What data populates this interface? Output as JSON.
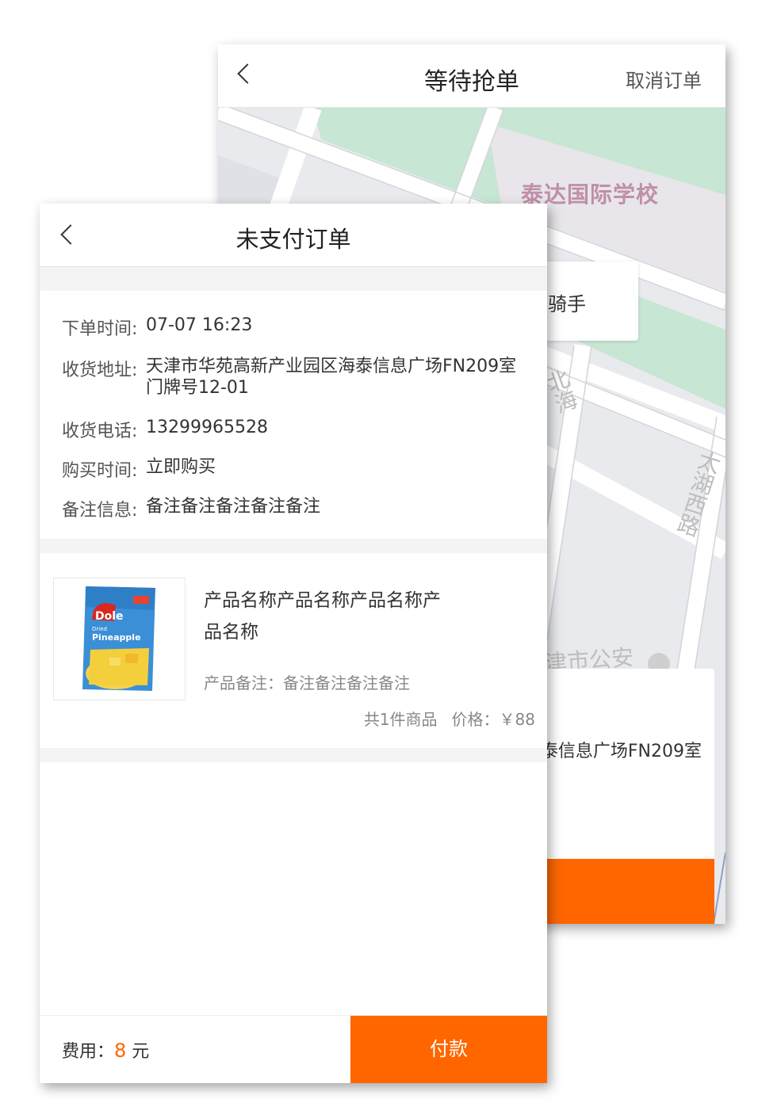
{
  "back_screen": {
    "title": "等待抢单",
    "cancel_label": "取消订单",
    "map": {
      "school_label": "泰达国际学校",
      "street_label_1": "北海",
      "street_label_2": "太湖西路",
      "poi_label": "津市公安"
    },
    "rider_label": "骑手",
    "address_partial": "泰信息广场FN209室"
  },
  "front_screen": {
    "title": "未支付订单",
    "order_info": {
      "order_time_label": "下单时间:",
      "order_time": "07-07 16:23",
      "address_label": "收货地址:",
      "address": "天津市华苑高新产业园区海泰信息广场FN209室门牌号12-01",
      "phone_label": "收货电话:",
      "phone": "13299965528",
      "purchase_time_label": "购买时间:",
      "purchase_time": "立即购买",
      "remark_label": "备注信息:",
      "remark": "备注备注备注备注备注"
    },
    "product": {
      "name": "产品名称产品名称产品名称产品名称",
      "note": "产品备注：备注备注备注备注",
      "count_text": "共1件商品",
      "price_text": "价格：￥88",
      "image_brand": "Dole",
      "image_text_1": "Dried",
      "image_text_2": "Pineapple"
    },
    "footer": {
      "fee_label": "费用：",
      "fee_amount": "8",
      "fee_unit": "元",
      "pay_label": "付款"
    }
  },
  "colors": {
    "accent": "#ff6600",
    "map_background": "#e9eaee",
    "map_green": "#bfe3cf"
  }
}
